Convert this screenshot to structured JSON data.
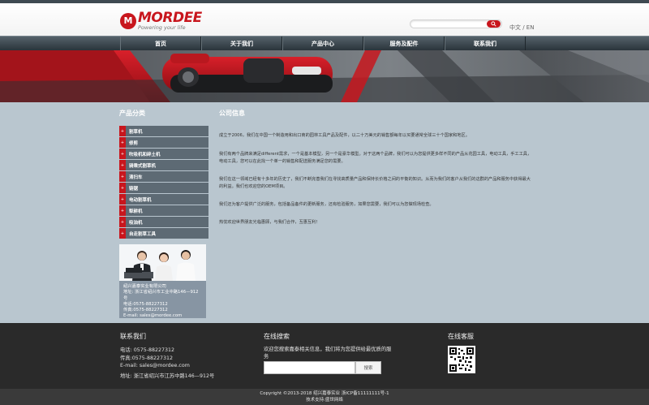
{
  "brand": {
    "logo_letter": "M",
    "logo_name": "MORDEE",
    "slogan": "Powering your life",
    "accent_color": "#c8161d"
  },
  "header": {
    "language": "中文 / EN",
    "search_icon": "search-icon"
  },
  "nav": {
    "items": [
      {
        "label": "首页"
      },
      {
        "label": "关于我们"
      },
      {
        "label": "产品中心"
      },
      {
        "label": "服务及配件"
      },
      {
        "label": "联系我们"
      }
    ]
  },
  "sidebar": {
    "title": "产品分类",
    "items": [
      {
        "label": "割草机"
      },
      {
        "label": "修剪"
      },
      {
        "label": "吹吸机和碎土机"
      },
      {
        "label": "骑乘式割草机"
      },
      {
        "label": "清扫车"
      },
      {
        "label": "链锯"
      },
      {
        "label": "电动割草机"
      },
      {
        "label": "犁耕机"
      },
      {
        "label": "吸油机"
      },
      {
        "label": "自走割草工具"
      }
    ],
    "contact": {
      "company": "绍兴嘉泰实业有限公司",
      "address": "地址: 浙江省绍兴市工业中路146—912号",
      "phone": "电话:0575-88227312",
      "fax": "传真:0575-88227312",
      "email": "E-mail: sales@mordee.com"
    }
  },
  "content": {
    "title": "公司信息",
    "paragraphs": [
      "成立于2006，我们在中国一个制造用和出口商的园林工具产品及配件，以二十万美元的销售额每年以买要通常全球三十个国家和地区。",
      "我们有两个品牌来满足different需求，一个是基本模型，另一个是豪华模型。对于这两个品牌，我们可以为您提供更多样不同的产品从花园工具，电动工具，手工工具，电动工具，您可以在此找一个单一的销售和配送服务满足您的需要。",
      "我们在这一领域已经有十多年的历史了，我们不断完善我们在寻找高质量产品和保持长价格之间的平衡的知识。从而为我们的客户从我们的这群的产品和服务中获得最大的利益。我们也欢迎您的OEM项目。",
      "我们还为客户提供广泛的服务，包括备品备件的更新服务，还有检验服务，如果您需要，我们可以为您做现场检查。",
      "热忱欢迎世界朋友光临惠顾，与我们合作，互惠互利！"
    ]
  },
  "footer": {
    "contact_title": "联系我们",
    "phone": "电话: 0575-88227312",
    "fax": "传真:0575-88227312",
    "email": "E-mail: sales@mordee.com",
    "address": "地址: 浙江省绍兴市江苏中路146—912号",
    "search_title": "在线搜索",
    "search_text_1": "欢迎您搜索嘉泰相关信息，我们将为您提供给最优质的服",
    "search_text_2": "务",
    "search_button": "搜索",
    "service_title": "在线客服"
  },
  "bottom": {
    "copyright": "Copyright ©2013-2018 绍兴嘉泰实业 浙ICP备11111111号-1",
    "support": "技术支持:盛世网络"
  }
}
